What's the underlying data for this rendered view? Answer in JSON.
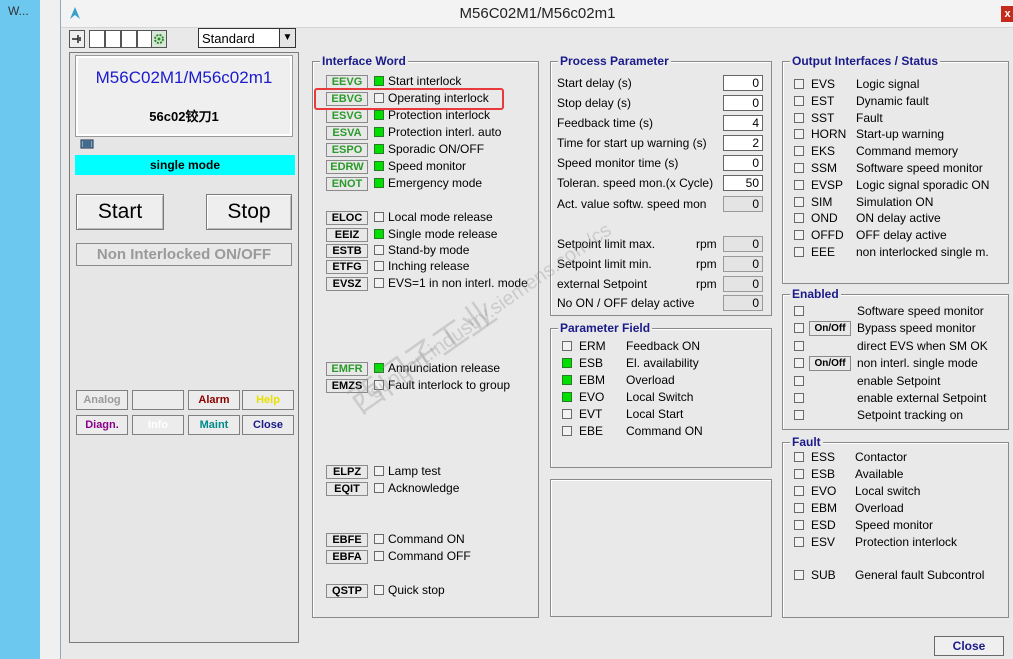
{
  "taskbar": {
    "item_label": "W..."
  },
  "window": {
    "title": "M56C02M1/M56c02m1",
    "close_glyph": "x"
  },
  "toolbar": {
    "view_select": "Standard"
  },
  "faceplate": {
    "name": "M56C02M1/M56c02m1",
    "description": "56c02铰刀1",
    "mode": "single mode",
    "start_label": "Start",
    "stop_label": "Stop",
    "non_interlocked_label": "Non Interlocked ON/OFF",
    "buttons_row1": [
      "Analog",
      "",
      "Alarm",
      "Help"
    ],
    "buttons_row2": [
      "Diagn.",
      "Info",
      "Maint",
      "Close"
    ]
  },
  "interface_word": {
    "title": "Interface Word",
    "items": [
      {
        "code": "EEVG",
        "label": "Start interlock",
        "on": true,
        "green": true
      },
      {
        "code": "EBVG",
        "label": "Operating interlock",
        "on": false,
        "green": true
      },
      {
        "code": "ESVG",
        "label": "Protection interlock",
        "on": true,
        "green": true
      },
      {
        "code": "ESVA",
        "label": "Protection interl. auto",
        "on": true,
        "green": true
      },
      {
        "code": "ESPO",
        "label": "Sporadic ON/OFF",
        "on": true,
        "green": true
      },
      {
        "code": "EDRW",
        "label": "Speed monitor",
        "on": true,
        "green": true
      },
      {
        "code": "ENOT",
        "label": "Emergency mode",
        "on": true,
        "green": true
      },
      {
        "code": "ELOC",
        "label": "Local mode release",
        "on": false,
        "green": false
      },
      {
        "code": "EEIZ",
        "label": "Single mode release",
        "on": true,
        "green": false
      },
      {
        "code": "ESTB",
        "label": "Stand-by mode",
        "on": false,
        "green": false
      },
      {
        "code": "ETFG",
        "label": "Inching release",
        "on": false,
        "green": false
      },
      {
        "code": "EVSZ",
        "label": "EVS=1 in non interl. mode",
        "on": false,
        "green": false
      },
      {
        "code": "EMFR",
        "label": "Annunciation release",
        "on": true,
        "green": true
      },
      {
        "code": "EMZS",
        "label": "Fault interlock to group",
        "on": false,
        "green": false
      },
      {
        "code": "ELPZ",
        "label": "Lamp test",
        "on": false,
        "green": false
      },
      {
        "code": "EQIT",
        "label": "Acknowledge",
        "on": false,
        "green": false
      },
      {
        "code": "EBFE",
        "label": "Command ON",
        "on": false,
        "green": false
      },
      {
        "code": "EBFA",
        "label": "Command OFF",
        "on": false,
        "green": false
      },
      {
        "code": "QSTP",
        "label": "Quick stop",
        "on": false,
        "green": false
      }
    ]
  },
  "process_parameter": {
    "title": "Process Parameter",
    "rows": [
      {
        "label": "Start delay (s)",
        "value": "0",
        "unit": "",
        "editable": true
      },
      {
        "label": "Stop delay (s)",
        "value": "0",
        "unit": "",
        "editable": true
      },
      {
        "label": "Feedback time (s)",
        "value": "4",
        "unit": "",
        "editable": true
      },
      {
        "label": "Time for start up warning (s)",
        "value": "2",
        "unit": "",
        "editable": true
      },
      {
        "label": "Speed monitor time (s)",
        "value": "0",
        "unit": "",
        "editable": true
      },
      {
        "label": "Toleran. speed mon.(x Cycle)",
        "value": "50",
        "unit": "",
        "editable": true
      },
      {
        "label": "Act. value softw. speed mon",
        "value": "0",
        "unit": "",
        "editable": false
      },
      {
        "label": "Setpoint limit max.",
        "value": "0",
        "unit": "rpm",
        "editable": false
      },
      {
        "label": "Setpoint limit min.",
        "value": "0",
        "unit": "rpm",
        "editable": false
      },
      {
        "label": "external Setpoint",
        "value": "0",
        "unit": "rpm",
        "editable": false
      },
      {
        "label": "No ON / OFF delay active",
        "value": "0",
        "unit": "",
        "editable": false
      }
    ]
  },
  "parameter_field": {
    "title": "Parameter Field",
    "items": [
      {
        "code": "ERM",
        "label": "Feedback ON",
        "on": false
      },
      {
        "code": "ESB",
        "label": "El. availability",
        "on": true
      },
      {
        "code": "EBM",
        "label": "Overload",
        "on": true
      },
      {
        "code": "EVO",
        "label": "Local Switch",
        "on": true
      },
      {
        "code": "EVT",
        "label": "Local Start",
        "on": false
      },
      {
        "code": "EBE",
        "label": "Command ON",
        "on": false
      }
    ]
  },
  "output_interfaces": {
    "title": "Output Interfaces / Status",
    "items": [
      {
        "code": "EVS",
        "label": "Logic signal"
      },
      {
        "code": "EST",
        "label": "Dynamic fault"
      },
      {
        "code": "SST",
        "label": "Fault"
      },
      {
        "code": "HORN",
        "label": "Start-up warning"
      },
      {
        "code": "EKS",
        "label": "Command memory"
      },
      {
        "code": "SSM",
        "label": "Software speed monitor"
      },
      {
        "code": "EVSP",
        "label": "Logic signal sporadic ON"
      },
      {
        "code": "SIM",
        "label": "Simulation ON"
      },
      {
        "code": "OND",
        "label": "ON delay active"
      },
      {
        "code": "OFFD",
        "label": "OFF delay active"
      },
      {
        "code": "EEE",
        "label": "non interlocked single m."
      }
    ]
  },
  "enabled": {
    "title": "Enabled",
    "items": [
      {
        "button": "",
        "label": "Software speed monitor"
      },
      {
        "button": "On/Off",
        "label": "Bypass speed monitor"
      },
      {
        "button": "",
        "label": "direct EVS when SM OK"
      },
      {
        "button": "On/Off",
        "label": "non interl. single mode"
      },
      {
        "button": "",
        "label": "enable Setpoint"
      },
      {
        "button": "",
        "label": "enable external Setpoint"
      },
      {
        "button": "",
        "label": "Setpoint tracking on"
      }
    ]
  },
  "fault": {
    "title": "Fault",
    "items": [
      {
        "code": "ESS",
        "label": "Contactor"
      },
      {
        "code": "ESB",
        "label": "Available"
      },
      {
        "code": "EVO",
        "label": "Local switch"
      },
      {
        "code": "EBM",
        "label": "Overload"
      },
      {
        "code": "ESD",
        "label": "Speed monitor"
      },
      {
        "code": "ESV",
        "label": "Protection interlock"
      },
      {
        "code": "SUB",
        "label": "General fault Subcontrol"
      }
    ]
  },
  "footer": {
    "close_label": "Close"
  },
  "watermark": {
    "line1": "西门子工业",
    "line2": "support.industry.siemens.com/cs"
  },
  "colors": {
    "led_on": "#00e000",
    "mode_bar": "#00ffff",
    "title_blue": "#1a1a8a",
    "highlight": "#e8393b"
  }
}
